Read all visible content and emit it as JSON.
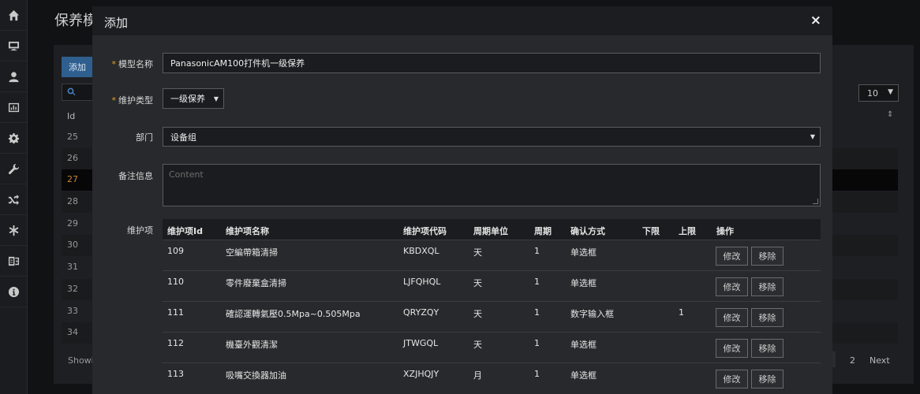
{
  "sidebar": {
    "items": [
      {
        "icon": "home-icon"
      },
      {
        "icon": "monitor-icon"
      },
      {
        "icon": "user-icon"
      },
      {
        "icon": "chart-icon"
      },
      {
        "icon": "gear-icon"
      },
      {
        "icon": "wrench-icon"
      },
      {
        "icon": "shuffle-icon"
      },
      {
        "icon": "asterisk-icon"
      },
      {
        "icon": "exchange-icon"
      },
      {
        "icon": "info-icon"
      }
    ]
  },
  "background": {
    "title": "保养模",
    "add_label": "添加",
    "id_header": "Id",
    "rows": [
      "25",
      "26",
      "27",
      "28",
      "29",
      "30",
      "31",
      "32",
      "33",
      "34"
    ],
    "page_size": "10",
    "showing": "Showi",
    "page_2": "2",
    "next": "Next"
  },
  "modal": {
    "title": "添加",
    "close": "×",
    "labels": {
      "model_name": "模型名称",
      "type": "维护类型",
      "department": "部门",
      "remarks": "备注信息",
      "items": "维护项"
    },
    "required_mark": "*",
    "values": {
      "model_name": "PanasonicAM100打件机一级保养",
      "type": "一级保养",
      "department": "设备组",
      "remarks_placeholder": "Content"
    },
    "table": {
      "headers": [
        "维护项Id",
        "维护项名称",
        "维护项代码",
        "周期单位",
        "周期",
        "确认方式",
        "下限",
        "上限",
        "操作"
      ],
      "rows": [
        {
          "id": "109",
          "name": "空編帶箱清掃",
          "code": "KBDXQL",
          "unit": "天",
          "period": "1",
          "method": "单选框",
          "lower": "",
          "upper": ""
        },
        {
          "id": "110",
          "name": "零件廢棄盒清掃",
          "code": "LJFQHQL",
          "unit": "天",
          "period": "1",
          "method": "单选框",
          "lower": "",
          "upper": ""
        },
        {
          "id": "111",
          "name": "確認運轉氣壓0.5Mpa~0.505Mpa",
          "code": "QRYZQY",
          "unit": "天",
          "period": "1",
          "method": "数字输入框",
          "lower": "",
          "upper": "1"
        },
        {
          "id": "112",
          "name": "機臺外觀清潔",
          "code": "JTWGQL",
          "unit": "天",
          "period": "1",
          "method": "单选框",
          "lower": "",
          "upper": ""
        },
        {
          "id": "113",
          "name": "吸嘴交換器加油",
          "code": "XZJHQJY",
          "unit": "月",
          "period": "1",
          "method": "单选框",
          "lower": "",
          "upper": ""
        }
      ],
      "edit_label": "修改",
      "remove_label": "移除"
    }
  }
}
